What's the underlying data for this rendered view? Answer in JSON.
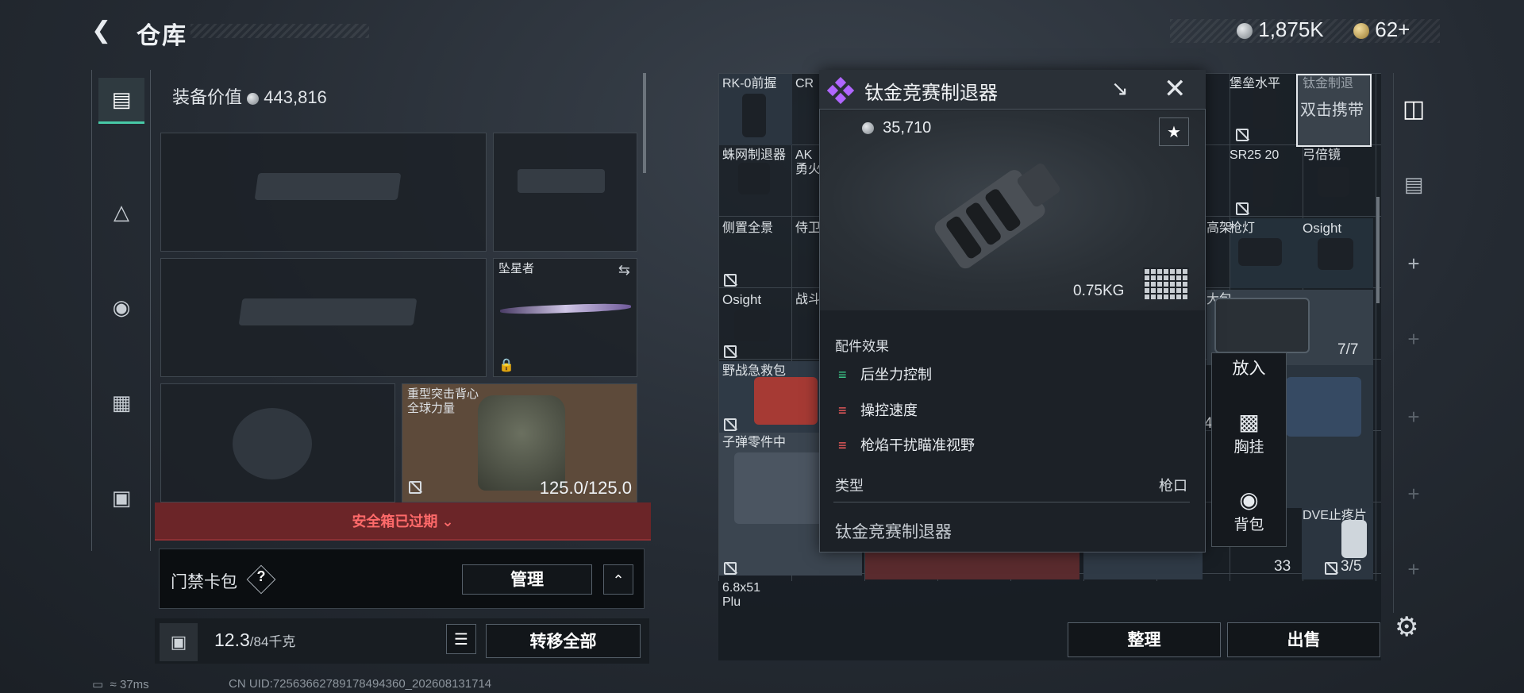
{
  "header": {
    "title": "仓库",
    "currency_silver": "1,875K",
    "currency_gold": "62+"
  },
  "equipment": {
    "value_label": "装备价值",
    "value": "443,816",
    "melee_label": "坠星者",
    "armor_label": "重型突击背心",
    "armor_sub": "全球力量",
    "armor_durability": "125.0/125.0",
    "safebox_warning": "安全箱已过期",
    "keycard_label": "门禁卡包",
    "keycard_help": "?",
    "manage_label": "管理",
    "weight": "12.3",
    "weight_cap": "/84千克",
    "transfer_all_label": "转移全部"
  },
  "stash": {
    "cells": [
      "RK-0前握",
      "CR",
      "堡垒水平",
      "钛金制退",
      "蛛网制退器",
      "AK",
      "勇火",
      "SR25 20",
      "弓倍镜",
      "侧置全景",
      "侍卫",
      "高架",
      "枪灯",
      "Osight",
      "Osight",
      "战斗",
      "大包",
      "野战急救包",
      "子弹零件中",
      "DVE止疼片",
      "6.8x51",
      "Plu"
    ],
    "selected_cell_overlay": "双击携带",
    "count_1": "7/7",
    "count_2": "33",
    "count_3": "3/5",
    "count_4": "4",
    "sort_label": "整理",
    "sell_label": "出售"
  },
  "popup": {
    "title": "钛金竞赛制退器",
    "price": "35,710",
    "weight": "0.75KG",
    "effects_title": "配件效果",
    "effects": [
      {
        "label": "后坐力控制",
        "direction": "up"
      },
      {
        "label": "操控速度",
        "direction": "down"
      },
      {
        "label": "枪焰干扰瞄准视野",
        "direction": "down"
      }
    ],
    "type_label": "类型",
    "type_value": "枪口",
    "name_footer": "钛金竞赛制退器"
  },
  "context_menu": {
    "put_label": "放入",
    "chest_label": "胸挂",
    "backpack_label": "背包"
  },
  "footer": {
    "ping": "37ms",
    "uid": "CN UID:725636627891784943​60_202608131714"
  },
  "colors": {
    "accent_green": "#48c9a7",
    "warning_red": "#ff6a6a",
    "effect_up": "#3fd491",
    "effect_down": "#ff6060",
    "rarity_purple": "#b066ff"
  }
}
